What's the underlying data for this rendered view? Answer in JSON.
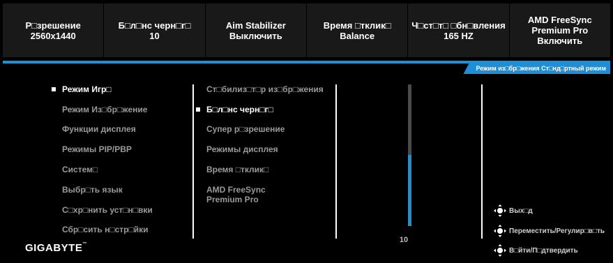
{
  "top_bar": [
    {
      "text": "Р□зрешение\n2560x1440"
    },
    {
      "text": "Б□л□нс черн□г□\n10"
    },
    {
      "text": "Aim Stabilizer\nВыключить"
    },
    {
      "text": "Время □тклик□\nBalance"
    },
    {
      "text": "Ч□ст□т□ □бн□вления\n165 HZ"
    },
    {
      "text": "AMD FreeSync\nPremium Pro\nВключить"
    }
  ],
  "mode_tab": "Режим из□бр□жения  Ст□нд□ртный режим",
  "main_menu": [
    {
      "label": "Режим Игр□",
      "active": true
    },
    {
      "label": "Режим Из□бр□жение"
    },
    {
      "label": "Функции дисплея"
    },
    {
      "label": "Режимы PIP/PBP"
    },
    {
      "label": "Систем□"
    },
    {
      "label": "Выбр□ть язык"
    },
    {
      "label": "С□хр□нить уст□н□вки"
    },
    {
      "label": "Сбр□сить н□стр□йки"
    }
  ],
  "sub_menu": [
    {
      "label": "Ст□билиз□т□р из□бр□жения"
    },
    {
      "label": "Б□л□нс черн□г□",
      "active": true
    },
    {
      "label": "Супер р□зрешение"
    },
    {
      "label": "Режимы дисплея"
    },
    {
      "label": "Время □тклик□"
    },
    {
      "label": "AMD FreeSync\nPremium Pro"
    }
  ],
  "slider": {
    "value": "10",
    "level_fraction": 0.5
  },
  "hints": [
    {
      "label": "Вых□д"
    },
    {
      "label": "Переместить/Регулир□в□ть"
    },
    {
      "label": "В□йти/П□дтвердить"
    }
  ],
  "brand": "GIGABYTE",
  "colors": {
    "accent": "#1e8fd6",
    "bar_bg": "#191919",
    "inactive_text": "#9a9a9a"
  }
}
